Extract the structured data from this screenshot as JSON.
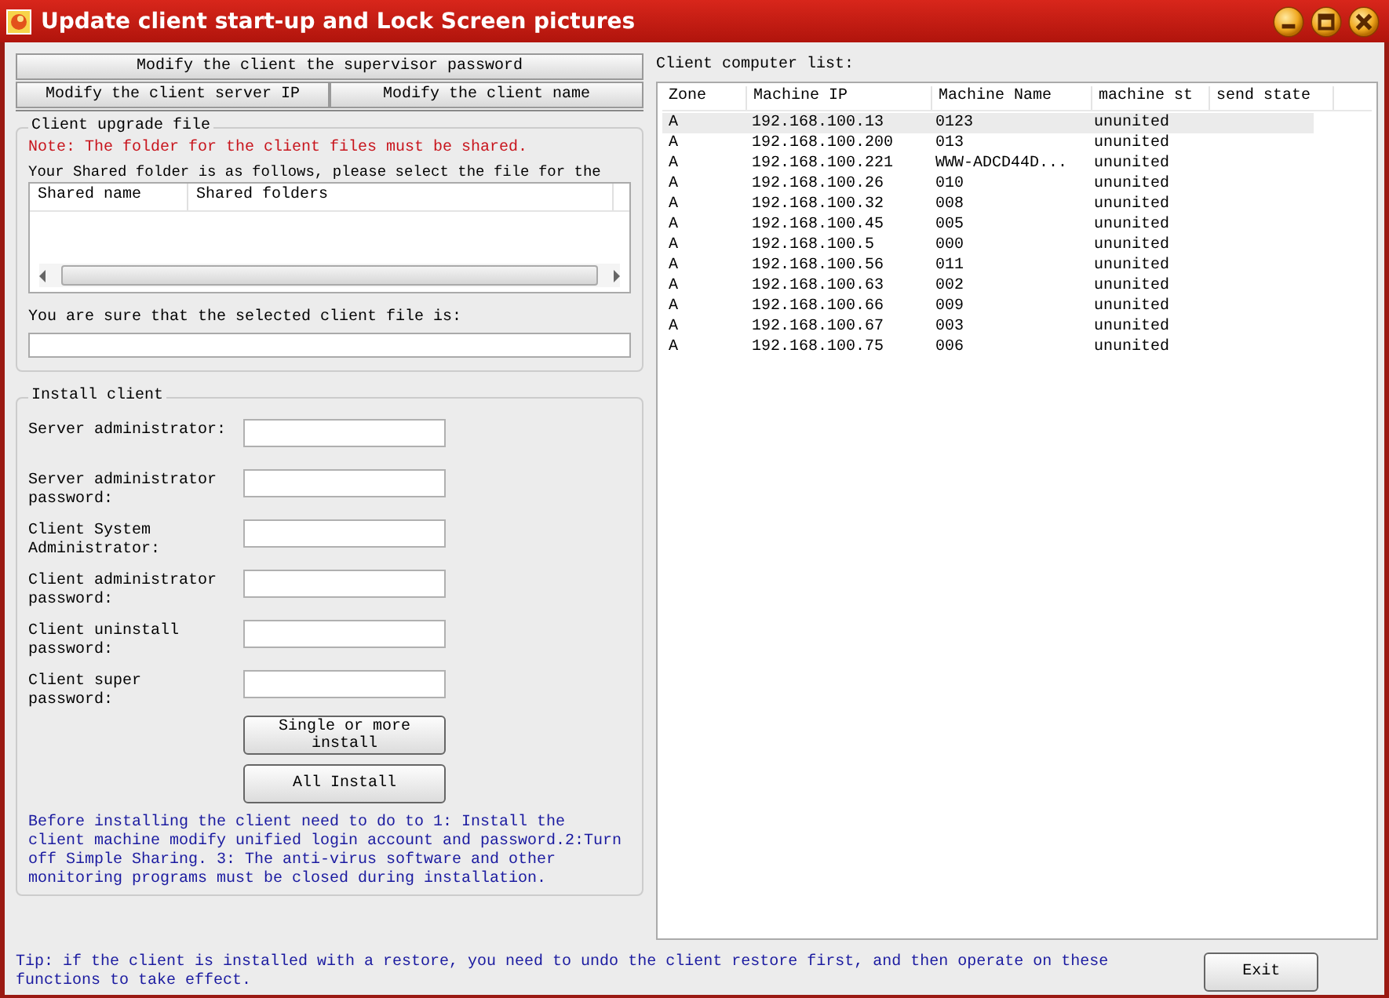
{
  "window": {
    "title": "Update client start-up and Lock Screen pictures"
  },
  "function_buttons": [
    {
      "label": "Modify the client the supervisor password"
    },
    {
      "label": "Modify the client server IP"
    },
    {
      "label": "Modify the client name"
    }
  ],
  "upgrade_group": {
    "title": "Client upgrade file",
    "note": "Note: The folder for the client files must be shared.",
    "instruction": "Your Shared folder is as follows, please select the file for the",
    "shared_table": {
      "columns": [
        "Shared name",
        "Shared folders"
      ]
    },
    "confirm_label": "You are sure that the selected client file is:"
  },
  "install_group": {
    "title": "Install client",
    "fields": [
      {
        "label": "Server administrator:"
      },
      {
        "label": "Server administrator password:"
      },
      {
        "label": "Client System Administrator:"
      },
      {
        "label": "Client administrator password:"
      },
      {
        "label": "Client uninstall password:"
      },
      {
        "label": "Client super password:"
      }
    ],
    "buttons": [
      "Single or more install",
      "All Install"
    ],
    "instructions": "Before installing the client need to do to 1: Install the client machine modify unified login account and password.2:Turn off Simple Sharing. 3: The anti-virus software and other monitoring programs must be closed during installation."
  },
  "client_list": {
    "label": "Client computer list:",
    "columns": [
      "Zone",
      "Machine IP",
      "Machine Name",
      "machine st",
      "send state"
    ],
    "rows": [
      {
        "cells": [
          "A",
          "192.168.100.13",
          "0123",
          "ununited"
        ],
        "selected": true
      },
      {
        "cells": [
          "A",
          "192.168.100.200",
          "013",
          "ununited"
        ],
        "selected": false
      },
      {
        "cells": [
          "A",
          "192.168.100.221",
          "WWW-ADCD44D...",
          "ununited"
        ],
        "selected": false
      },
      {
        "cells": [
          "A",
          "192.168.100.26",
          "010",
          "ununited"
        ],
        "selected": false
      },
      {
        "cells": [
          "A",
          "192.168.100.32",
          "008",
          "ununited"
        ],
        "selected": false
      },
      {
        "cells": [
          "A",
          "192.168.100.45",
          "005",
          "ununited"
        ],
        "selected": false
      },
      {
        "cells": [
          "A",
          "192.168.100.5",
          "000",
          "ununited"
        ],
        "selected": false
      },
      {
        "cells": [
          "A",
          "192.168.100.56",
          "011",
          "ununited"
        ],
        "selected": false
      },
      {
        "cells": [
          "A",
          "192.168.100.63",
          "002",
          "ununited"
        ],
        "selected": false
      },
      {
        "cells": [
          "A",
          "192.168.100.66",
          "009",
          "ununited"
        ],
        "selected": false
      },
      {
        "cells": [
          "A",
          "192.168.100.67",
          "003",
          "ununited"
        ],
        "selected": false
      },
      {
        "cells": [
          "A",
          "192.168.100.75",
          "006",
          "ununited"
        ],
        "selected": false
      }
    ]
  },
  "tip": "Tip: if the client is installed with a restore, you need to undo the client restore first, and then operate on these functions to take effect.",
  "exit_button": "Exit"
}
